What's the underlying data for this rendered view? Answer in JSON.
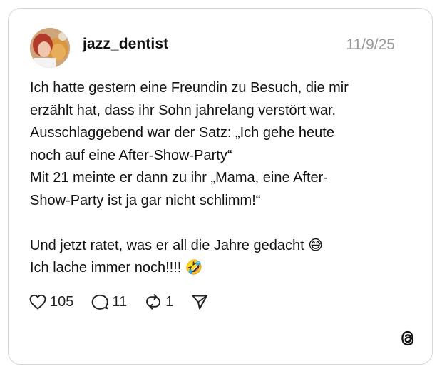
{
  "post": {
    "username": "jazz_dentist",
    "date": "11/9/25",
    "text": "Ich hatte gestern eine Freundin zu Besuch, die mir\nerzählt hat, dass ihr Sohn jahrelang verstört war.\nAusschlaggebend war der Satz: „Ich gehe heute\nnoch auf eine After-Show-Party“\nMit 21 meinte er dann zu ihr „Mama, eine After-\nShow-Party ist ja gar nicht schlimm!“\n\nUnd jetzt ratet, was er all die Jahre gedacht 😅\nIch lache immer noch!!!! 🤣"
  },
  "actions": {
    "likes": "105",
    "replies": "11",
    "reposts": "1"
  },
  "icons": {
    "like": "heart-icon",
    "reply": "comment-bubble-icon",
    "repost": "repost-icon",
    "share": "send-icon",
    "brand": "threads-logo-icon"
  },
  "colors": {
    "border": "#d6d6d6",
    "date": "#9a9a9a",
    "text": "#111111"
  }
}
